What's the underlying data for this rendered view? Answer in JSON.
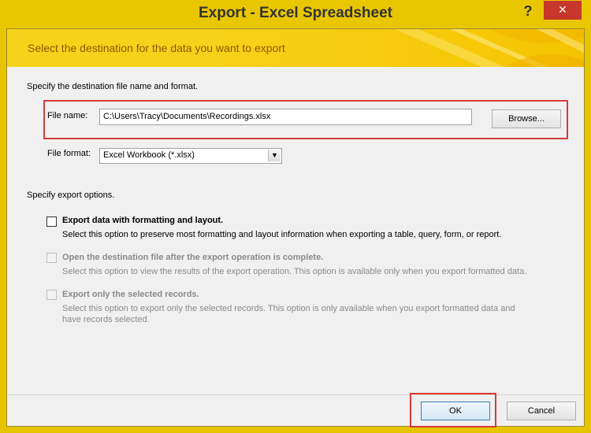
{
  "window": {
    "title": "Export - Excel Spreadsheet",
    "help_label": "?",
    "close_label": "✕",
    "accent_color": "#e9c700"
  },
  "banner": {
    "text": "Select the destination for the data you want to export"
  },
  "destination": {
    "heading": "Specify the destination file name and format.",
    "file_name_label": "File name:",
    "file_name_value": "C:\\Users\\Tracy\\Documents\\Recordings.xlsx",
    "browse_label": "Browse...",
    "file_format_label": "File format:",
    "file_format_value": "Excel Workbook (*.xlsx)"
  },
  "options": {
    "heading": "Specify export options.",
    "items": [
      {
        "label": "Export data with formatting and layout.",
        "description": "Select this option to preserve most formatting and layout information when exporting a table, query, form, or report.",
        "checked": false,
        "enabled": true
      },
      {
        "label": "Open the destination file after the export operation is complete.",
        "description": "Select this option to view the results of the export operation. This option is available only when you export formatted data.",
        "checked": false,
        "enabled": false
      },
      {
        "label": "Export only the selected records.",
        "description_line1": "Select this option to export only the selected records. This option is only available when you export formatted data and",
        "description_line2": "have records selected.",
        "checked": false,
        "enabled": false
      }
    ]
  },
  "footer": {
    "ok_label": "OK",
    "cancel_label": "Cancel"
  }
}
